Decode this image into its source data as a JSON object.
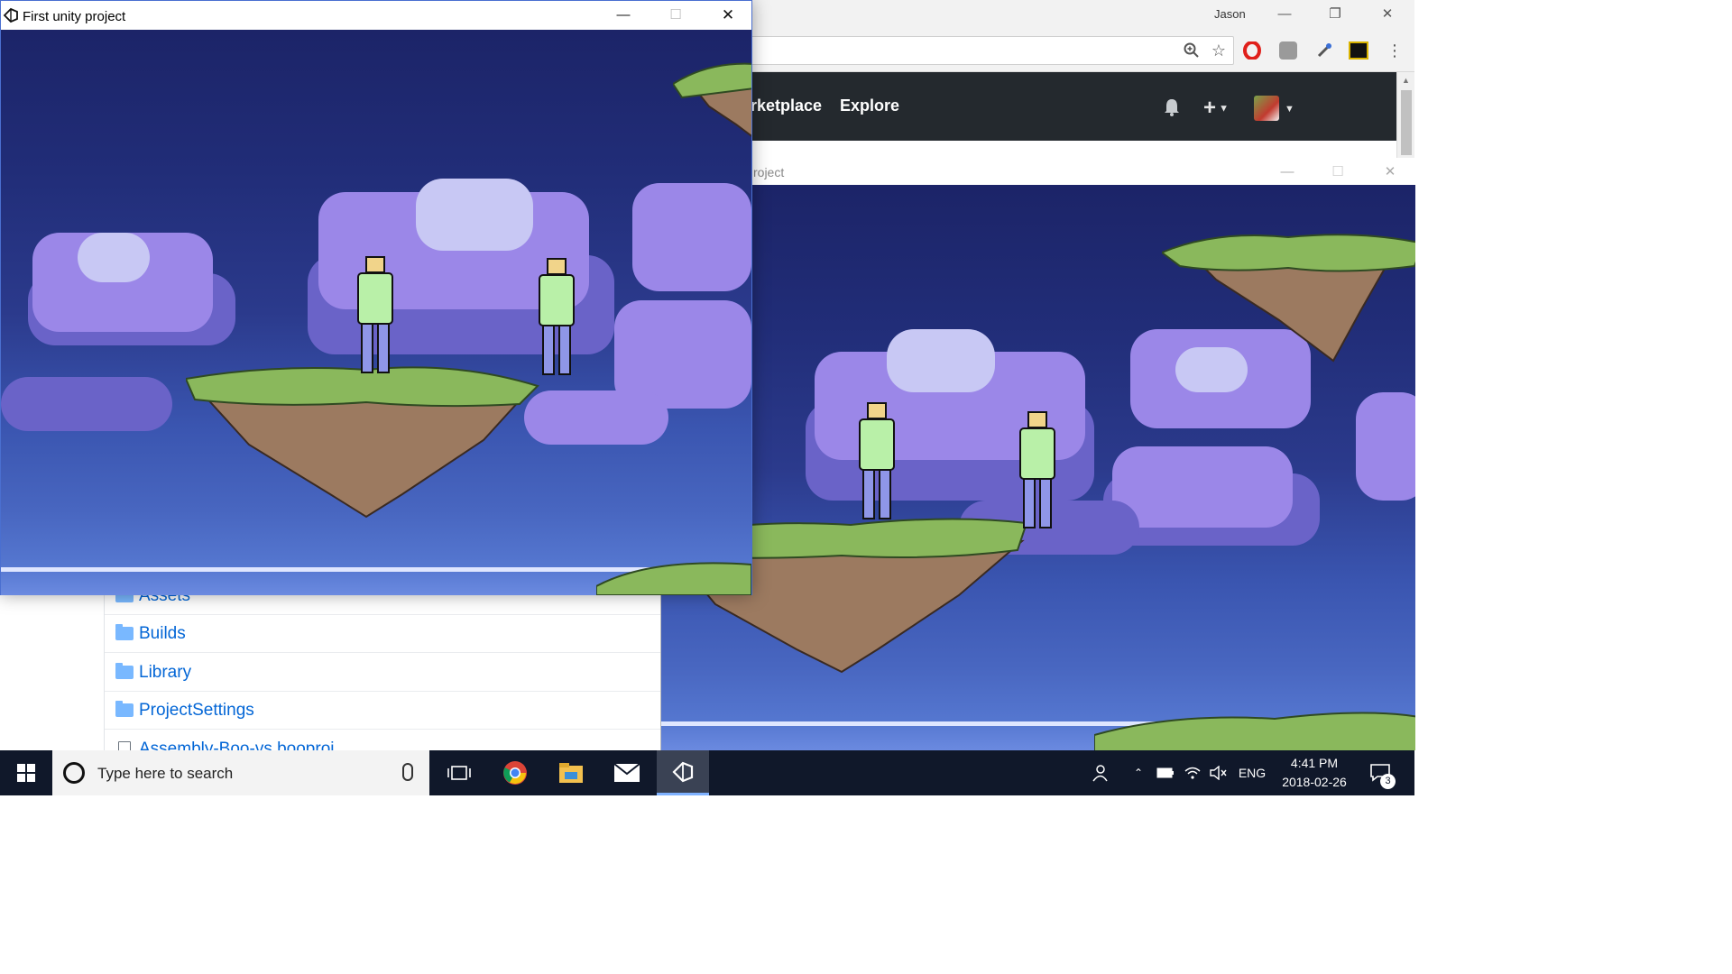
{
  "chrome": {
    "user": "Jason",
    "nav": {
      "marketplace": "rketplace",
      "explore": "Explore"
    }
  },
  "repo_files": [
    {
      "name": "Assets",
      "type": "folder"
    },
    {
      "name": "Builds",
      "type": "folder"
    },
    {
      "name": "Library",
      "type": "folder"
    },
    {
      "name": "ProjectSettings",
      "type": "folder"
    },
    {
      "name": "Assembly-Boo-vs.booproj",
      "type": "file"
    }
  ],
  "game_window_front": {
    "title": "First unity project"
  },
  "game_window_back": {
    "title": "roject"
  },
  "taskbar": {
    "search_placeholder": "Type here to search",
    "language": "ENG",
    "time": "4:41 PM",
    "date": "2018-02-26",
    "notification_count": "3"
  },
  "colors": {
    "github_header": "#24292e",
    "link": "#0366d6",
    "sky_top": "#1c2468",
    "sky_bottom": "#6b8ae0",
    "taskbar": "#10182a"
  }
}
